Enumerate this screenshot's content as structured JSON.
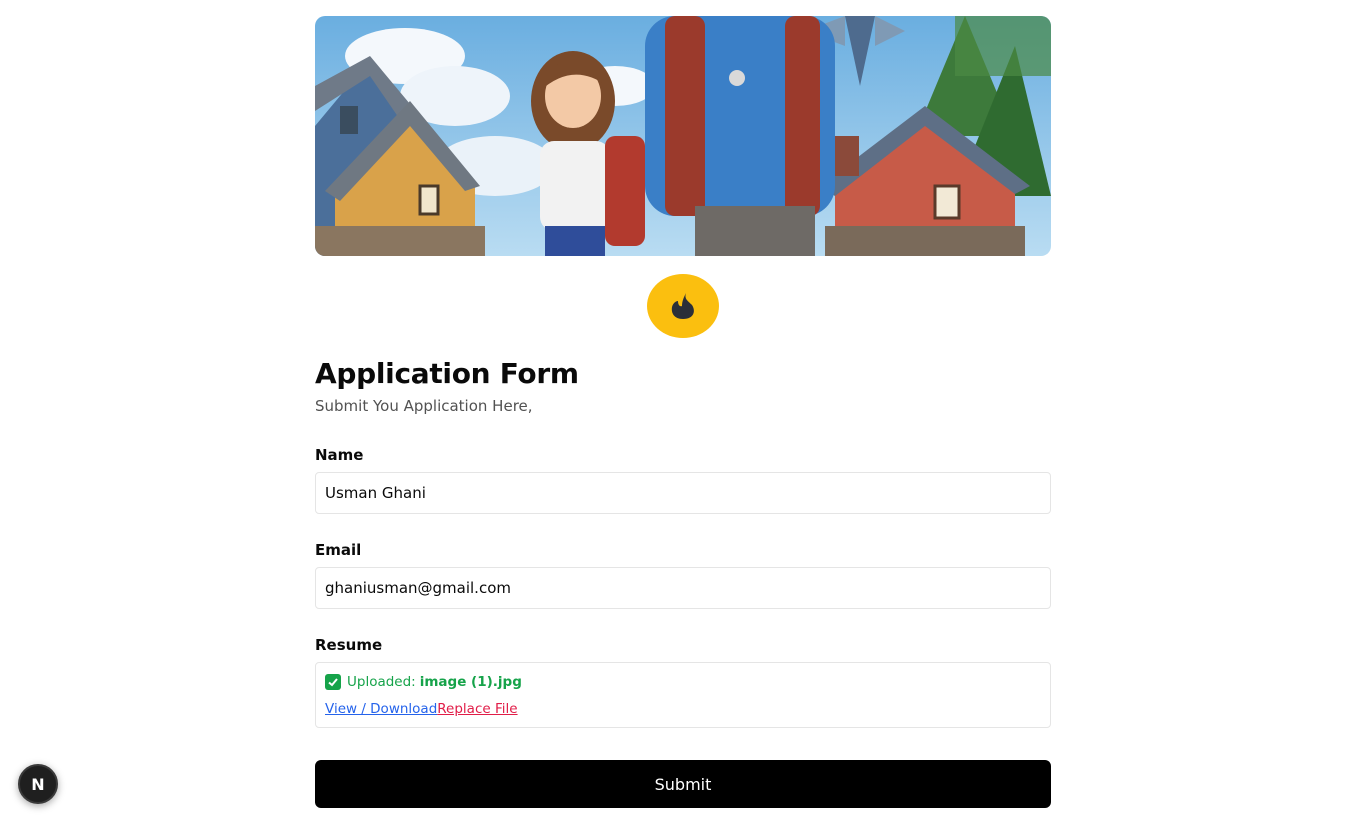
{
  "form": {
    "title": "Application Form",
    "subtitle": "Submit You Application Here,",
    "name_label": "Name",
    "name_value": "Usman Ghani",
    "email_label": "Email",
    "email_value": "ghaniusman@gmail.com",
    "resume_label": "Resume",
    "upload_prefix": "Uploaded:",
    "upload_filename": "image (1).jpg",
    "view_link": "View / Download",
    "replace_link": "Replace File",
    "submit_label": "Submit"
  },
  "badge": {
    "letter": "N"
  },
  "colors": {
    "logo_bg": "#fbbf0f",
    "success": "#16a34a",
    "link_blue": "#2563eb",
    "link_red": "#e11d48",
    "button_bg": "#000000"
  },
  "icons": [
    "flame-logo-icon",
    "check-icon",
    "nextjs-badge-icon"
  ]
}
